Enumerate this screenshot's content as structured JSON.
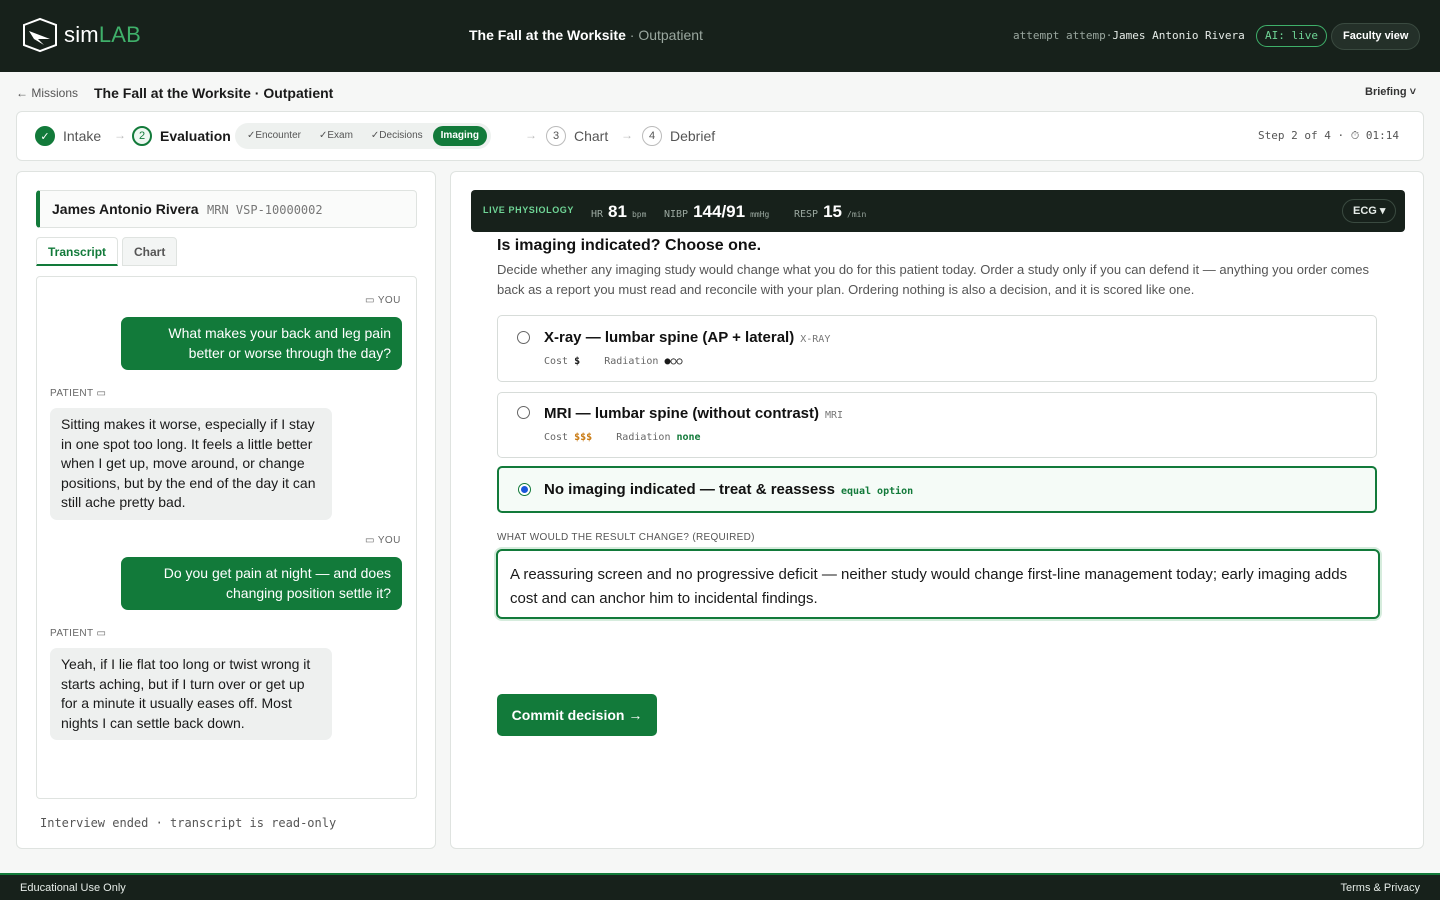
{
  "app": {
    "brand_sim": "sim",
    "brand_lab": "LAB"
  },
  "topbar": {
    "title": "The Fall at the Worksite",
    "subtitle": "· Outpatient",
    "attempt_prefix": "attempt attemp·",
    "user_name": "James Antonio Rivera",
    "ai_status": "AI: live",
    "faculty_button": "Faculty view"
  },
  "breadcrumb": {
    "back": "← Missions",
    "title": "The Fall at the Worksite · Outpatient",
    "briefing": "Briefing ˅"
  },
  "stepper": {
    "steps": [
      {
        "num": "✓",
        "label": "Intake",
        "state": "done"
      },
      {
        "num": "2",
        "label": "Evaluation",
        "state": "active"
      },
      {
        "num": "3",
        "label": "Chart",
        "state": "todo"
      },
      {
        "num": "4",
        "label": "Debrief",
        "state": "todo"
      }
    ],
    "substeps": [
      "✓Encounter",
      "✓Exam",
      "✓Decisions",
      "Imaging"
    ],
    "info": "Step 2 of 4 · ⏱ 01:14"
  },
  "patient": {
    "name": "James Antonio Rivera",
    "mrn": "MRN VSP-10000002"
  },
  "left_tabs": [
    "Transcript",
    "Chart"
  ],
  "transcript": {
    "you_label": "▭ YOU",
    "patient_label": "PATIENT ▭",
    "messages": [
      {
        "from": "you",
        "text": "What makes your back and leg pain better or worse through the day?"
      },
      {
        "from": "patient",
        "text": "Sitting makes it worse, especially if I stay in one spot too long. It feels a little better when I get up, move around, or change positions, but by the end of the day it can still ache pretty bad."
      },
      {
        "from": "you",
        "text": "Do you get pain at night — and does changing position settle it?"
      },
      {
        "from": "patient",
        "text": "Yeah, if I lie flat too long or twist wrong it starts aching, but if I turn over or get up for a minute it usually eases off. Most nights I can settle back down."
      }
    ],
    "ended": "Interview ended · transcript is read-only"
  },
  "vitals": {
    "label": "LIVE PHYSIOLOGY",
    "hr": {
      "key": "HR",
      "value": "81",
      "unit": "bpm"
    },
    "nibp": {
      "key": "NIBP",
      "value": "144/91",
      "unit": "mmHg"
    },
    "resp": {
      "key": "RESP",
      "value": "15",
      "unit": "/min"
    },
    "ecg_button": "ECG ▾"
  },
  "question": {
    "title": "Is imaging indicated? Choose one.",
    "description": "Decide whether any imaging study would change what you do for this patient today. Order a study only if you can defend it — anything you order comes back as a report you must read and reconcile with your plan. Ordering nothing is also a decision, and it is scored like one.",
    "options": [
      {
        "title": "X-ray — lumbar spine (AP + lateral)",
        "tag": "X-RAY",
        "cost_label": "Cost",
        "cost": "$",
        "radiation_label": "Radiation",
        "radiation": "●○○",
        "selected": false
      },
      {
        "title": "MRI — lumbar spine (without contrast)",
        "tag": "MRI",
        "cost_label": "Cost",
        "cost": "$$$",
        "radiation_label": "Radiation",
        "radiation": "none",
        "selected": false
      },
      {
        "title": "No imaging indicated — treat & reassess",
        "tag": "equal option",
        "selected": true
      }
    ],
    "field_label": "WHAT WOULD THE RESULT CHANGE? (REQUIRED)",
    "answer": "A reassuring screen and no progressive deficit — neither study would change first-line management today; early imaging adds cost and can anchor him to incidental findings.",
    "commit_button": "Commit decision →"
  },
  "footer": {
    "left": "Educational Use Only",
    "right": "Terms & Privacy"
  }
}
